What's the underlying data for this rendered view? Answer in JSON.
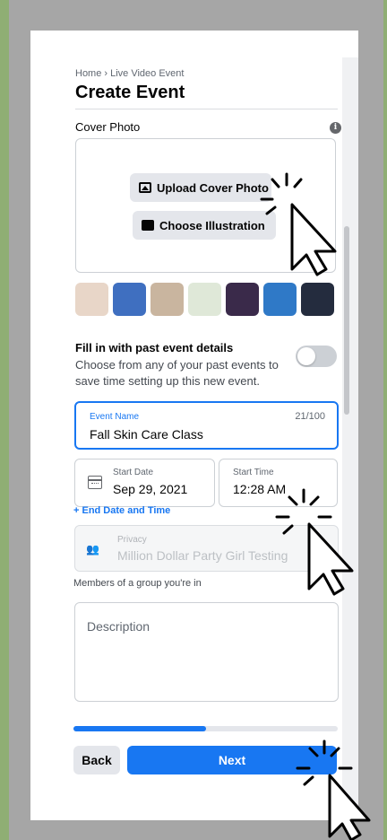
{
  "header": {
    "breadcrumb": "Home › Live Video Event",
    "title": "Create Event"
  },
  "cover": {
    "label": "Cover Photo",
    "upload_label": "Upload Cover Photo",
    "illustration_label": "Choose Illustration",
    "thumbnails": [
      "#e8d6c8",
      "#3f6fc0",
      "#c9b59f",
      "#dfe8d8",
      "#3a2a4a",
      "#2f79c7",
      "#242c3e"
    ]
  },
  "past_event": {
    "title": "Fill in with past event details",
    "description": "Choose from any of your past events to save time setting up this new event.",
    "toggle_on": false
  },
  "event_name": {
    "label": "Event Name",
    "count": "21/100",
    "value": "Fall Skin Care Class"
  },
  "start_date": {
    "label": "Start Date",
    "value": "Sep 29, 2021"
  },
  "start_time": {
    "label": "Start Time",
    "value": "12:28 AM"
  },
  "end_date_link": "+ End Date and Time",
  "privacy": {
    "label": "Privacy",
    "value": "Million Dollar Party Girl Testing",
    "help": "Members of a group you're in"
  },
  "description": {
    "placeholder": "Description"
  },
  "progress": {
    "fraction": 0.5
  },
  "footer": {
    "back_label": "Back",
    "next_label": "Next"
  },
  "colors": {
    "accent": "#1877f2",
    "frame": "#a6a6a6",
    "edge": "#8fae74"
  }
}
